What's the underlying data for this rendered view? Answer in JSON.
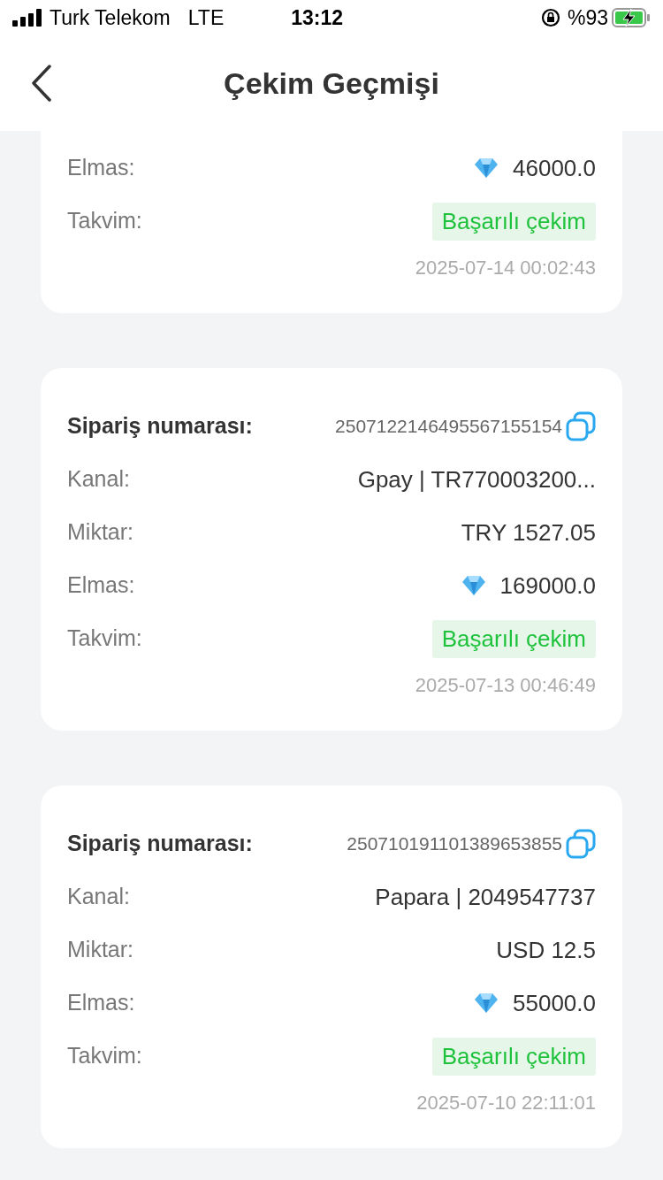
{
  "status_bar": {
    "carrier": "Turk Telekom",
    "network": "LTE",
    "time": "13:12",
    "battery": "%93"
  },
  "header": {
    "title": "Çekim Geçmişi"
  },
  "records": [
    {
      "rows": [
        {
          "kind": "diamond",
          "label": "Elmas:",
          "value": "46000.0"
        }
      ],
      "status_label": "Takvim:",
      "status": "Başarılı çekim",
      "date": "2025-07-14 00:02:43"
    },
    {
      "order_label": "Sipariş numarası:",
      "order_no": "2507122146495567155154",
      "rows": [
        {
          "kind": "text",
          "label": "Kanal:",
          "value": "Gpay | TR770003200..."
        },
        {
          "kind": "text",
          "label": "Miktar:",
          "value": "TRY 1527.05"
        },
        {
          "kind": "diamond",
          "label": "Elmas:",
          "value": "169000.0"
        }
      ],
      "status_label": "Takvim:",
      "status": "Başarılı çekim",
      "date": "2025-07-13 00:46:49"
    },
    {
      "order_label": "Sipariş numarası:",
      "order_no": "250710191101389653855",
      "rows": [
        {
          "kind": "text",
          "label": "Kanal:",
          "value": "Papara | 2049547737"
        },
        {
          "kind": "text",
          "label": "Miktar:",
          "value": "USD 12.5"
        },
        {
          "kind": "diamond",
          "label": "Elmas:",
          "value": "55000.0"
        }
      ],
      "status_label": "Takvim:",
      "status": "Başarılı çekim",
      "date": "2025-07-10 22:11:01"
    }
  ]
}
